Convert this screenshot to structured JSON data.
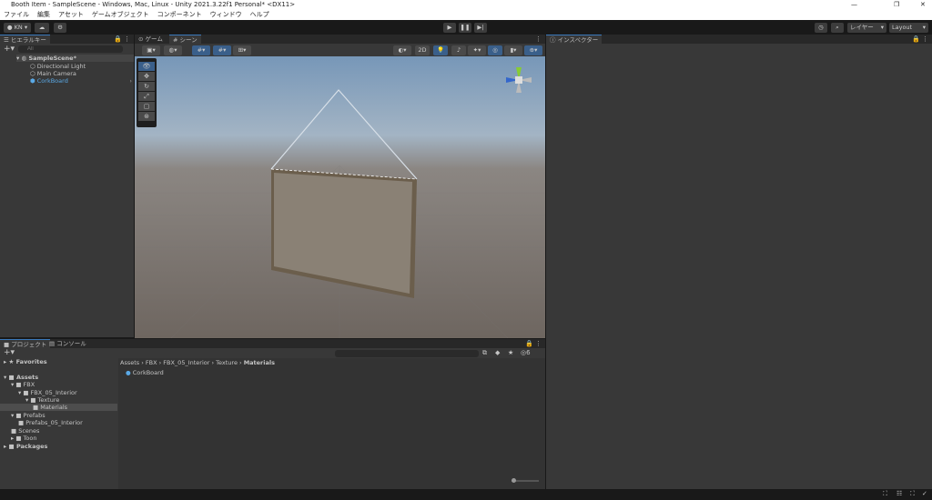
{
  "window": {
    "title": "Booth Item - SampleScene - Windows, Mac, Linux - Unity 2021.3.22f1 Personal* <DX11>",
    "minimize": "—",
    "maximize": "❐",
    "close": "✕"
  },
  "menu": [
    "ファイル",
    "編集",
    "アセット",
    "ゲームオブジェクト",
    "コンポーネント",
    "ウィンドウ",
    "ヘルプ"
  ],
  "toolbar": {
    "account": "KN",
    "layers": "レイヤー",
    "layout": "Layout"
  },
  "hierarchy": {
    "tab": "ヒエラルキー",
    "search_placeholder": "All",
    "scene": "SampleScene*",
    "items": [
      "Directional Light",
      "Main Camera",
      "CorkBoard"
    ]
  },
  "scene_view": {
    "tabs": [
      "ゲーム",
      "シーン"
    ],
    "mode_2d": "2D"
  },
  "inspector": {
    "tab": "インスペクター"
  },
  "project": {
    "tabs": [
      "プロジェクト",
      "コンソール"
    ],
    "favorites": "Favorites",
    "tree": [
      {
        "label": "Assets",
        "level": 0,
        "bold": true
      },
      {
        "label": "FBX",
        "level": 1
      },
      {
        "label": "FBX_05_Interior",
        "level": 2
      },
      {
        "label": "Texture",
        "level": 3
      },
      {
        "label": "Materials",
        "level": 4,
        "selected": true
      },
      {
        "label": "Prefabs",
        "level": 1
      },
      {
        "label": "Prefabs_05_Interior",
        "level": 2
      },
      {
        "label": "Scenes",
        "level": 1
      },
      {
        "label": "Toon",
        "level": 1
      },
      {
        "label": "Packages",
        "level": 0,
        "bold": true
      }
    ],
    "breadcrumb": [
      "Assets",
      "FBX",
      "FBX_05_Interior",
      "Texture",
      "Materials"
    ],
    "files": [
      "CorkBoard"
    ],
    "hidden_count": "6"
  },
  "colors": {
    "selected_object": "#5aa9e6",
    "accent": "#3a79bb"
  }
}
